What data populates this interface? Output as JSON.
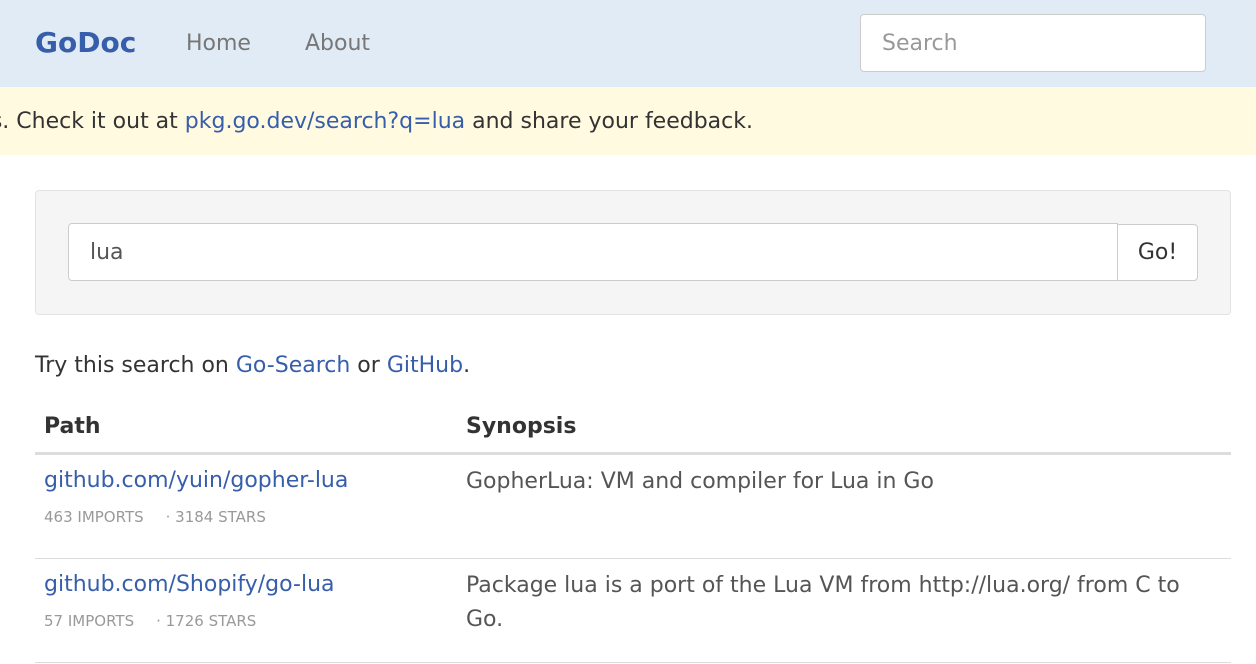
{
  "navbar": {
    "brand": "GoDoc",
    "links": [
      "Home",
      "About"
    ],
    "search_placeholder": "Search"
  },
  "banner": {
    "text_before": "s. Check it out at ",
    "link_text": "pkg.go.dev/search?q=lua",
    "text_after": " and share your feedback."
  },
  "search": {
    "value": "lua",
    "button_label": "Go!"
  },
  "try_line": {
    "prefix": "Try this search on ",
    "link1": "Go-Search",
    "middle": " or ",
    "link2": "GitHub",
    "suffix": "."
  },
  "table": {
    "headers": [
      "Path",
      "Synopsis"
    ],
    "rows": [
      {
        "path": "github.com/yuin/gopher-lua",
        "imports": "463 IMPORTS",
        "stars": "· 3184 STARS",
        "synopsis": "GopherLua: VM and compiler for Lua in Go"
      },
      {
        "path": "github.com/Shopify/go-lua",
        "imports": "57 IMPORTS",
        "stars": "· 1726 STARS",
        "synopsis": "Package lua is a port of the Lua VM from http://lua.org/ from C to Go."
      }
    ]
  },
  "colors": {
    "navbar_bg": "#e0ebf5",
    "brand": "#375eab",
    "link": "#375eab",
    "banner_bg": "#fffae0"
  }
}
